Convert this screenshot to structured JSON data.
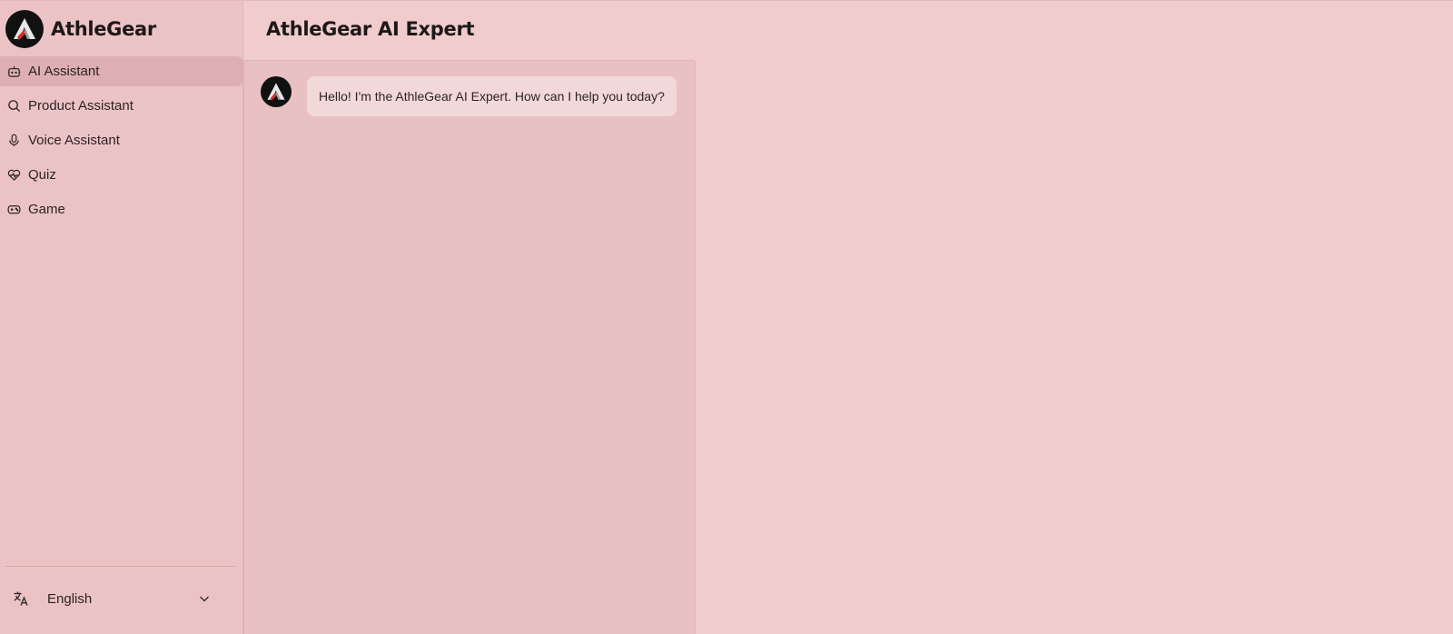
{
  "app": {
    "name": "AthleGear"
  },
  "sidebar": {
    "items": [
      {
        "label": "AI Assistant",
        "icon": "robot-icon",
        "active": true
      },
      {
        "label": "Product Assistant",
        "icon": "search-icon",
        "active": false
      },
      {
        "label": "Voice Assistant",
        "icon": "microphone-icon",
        "active": false
      },
      {
        "label": "Quiz",
        "icon": "heart-pulse-icon",
        "active": false
      },
      {
        "label": "Game",
        "icon": "gamepad-icon",
        "active": false
      }
    ],
    "language": {
      "selected": "English",
      "icon": "translate-icon"
    }
  },
  "main": {
    "title": "AthleGear AI Expert",
    "messages": [
      {
        "sender": "assistant",
        "text": "Hello! I'm the AthleGear AI Expert. How can I help you today?"
      }
    ]
  },
  "colors": {
    "background": "#f1cccd",
    "sidebar": "#ecc3c5",
    "active_item": "#deafb2",
    "bubble": "#f3d8d9",
    "logo": "#111111",
    "logo_accent": "#d32f2f"
  }
}
